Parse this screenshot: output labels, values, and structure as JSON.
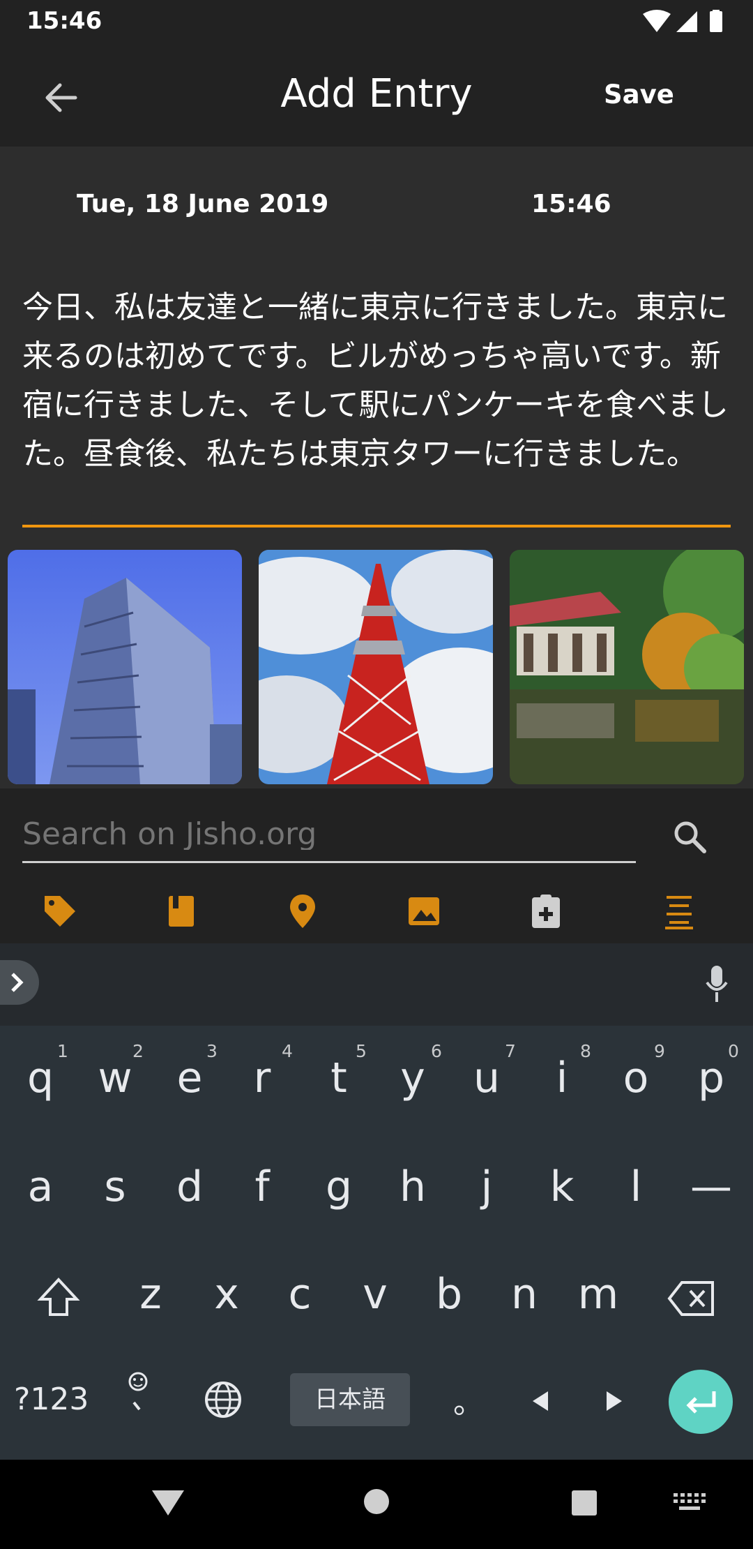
{
  "status_bar": {
    "time": "15:46"
  },
  "app_bar": {
    "title": "Add Entry",
    "save_label": "Save",
    "back_icon": "arrow-back-icon"
  },
  "entry": {
    "date": "Tue, 18 June 2019",
    "time": "15:46",
    "body": "今日、私は友達と一緒に東京に行きました。東京に来るのは初めてです。ビルがめっちゃ高いです。新宿に行きました、そして駅にパンケーキを食べました。昼食後、私たちは東京タワーに行きました。"
  },
  "photos": [
    "building-photo",
    "tokyo-tower-photo",
    "garden-pond-photo"
  ],
  "search": {
    "placeholder": "Search on Jisho.org"
  },
  "toolbar": {
    "icons": [
      "tag-icon",
      "book-icon",
      "location-pin-icon",
      "image-icon",
      "clipboard-add-icon",
      "text-lines-icon"
    ]
  },
  "keyboard": {
    "row1": [
      "q",
      "w",
      "e",
      "r",
      "t",
      "y",
      "u",
      "i",
      "o",
      "p"
    ],
    "row1_hints": [
      "1",
      "2",
      "3",
      "4",
      "5",
      "6",
      "7",
      "8",
      "9",
      "0"
    ],
    "row2": [
      "a",
      "s",
      "d",
      "f",
      "g",
      "h",
      "j",
      "k",
      "l",
      "—"
    ],
    "row3": [
      "z",
      "x",
      "c",
      "v",
      "b",
      "n",
      "m"
    ],
    "symbols_label": "?123",
    "space_label": "日本語",
    "period_label": "。"
  },
  "colors": {
    "accent": "#f0960f",
    "enter_key": "#5fd3c4",
    "toolbar_icon": "#d88a12"
  }
}
